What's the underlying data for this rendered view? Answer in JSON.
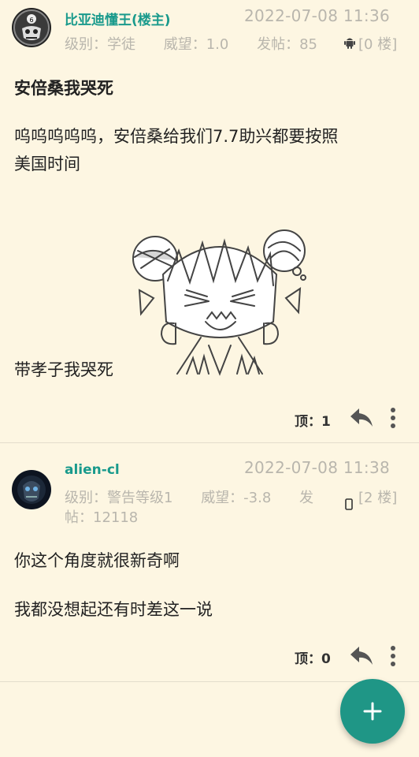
{
  "posts": [
    {
      "author": "比亚迪懂王(楼主)",
      "time": "2022-07-08 11:36",
      "level": "级别：学徒",
      "prestige": "威望：1.0",
      "post_count": "发帖：85",
      "device_icon": "android-icon",
      "floor": "[0 楼]",
      "title": "安倍桑我哭死",
      "body_lines": [
        "呜呜呜呜呜，安倍桑给我们7.7助兴都要按照",
        "美国时间"
      ],
      "caption": "带孝子我哭死",
      "like_label": "顶：1"
    },
    {
      "author": "alien-cl",
      "time": "2022-07-08 11:38",
      "level": "级别：警告等级1",
      "prestige": "威望：-3.8",
      "post_count_part1": "发",
      "post_count_part2": "帖：12118",
      "device_icon": "phone-icon",
      "floor": "[2 楼]",
      "body_lines": [
        "你这个角度就很新奇啊",
        "我都没想起还有时差这一说"
      ],
      "like_label": "顶：0"
    }
  ],
  "fab_icon": "plus-icon",
  "colors": {
    "accent": "#1f9686",
    "author": "#199a8c",
    "background": "#fdf6e2",
    "meta": "#b9b6ad"
  }
}
